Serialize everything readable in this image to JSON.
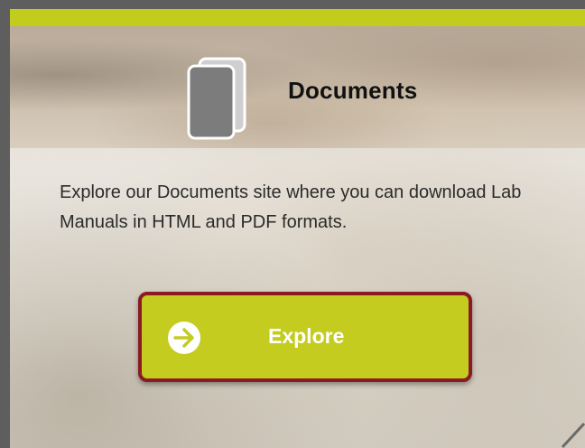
{
  "card": {
    "title": "Documents",
    "description": "Explore our Documents site where you can download Lab Manuals in HTML and PDF formats.",
    "button_label": "Explore",
    "icons": {
      "header": "documents-icon",
      "button": "arrow-right-circle-icon"
    }
  },
  "colors": {
    "accent": "#c2cc1c",
    "button_fill": "#c4cc1f",
    "button_highlight_border": "#8a1a24",
    "frame_border": "#5e5e5e"
  }
}
